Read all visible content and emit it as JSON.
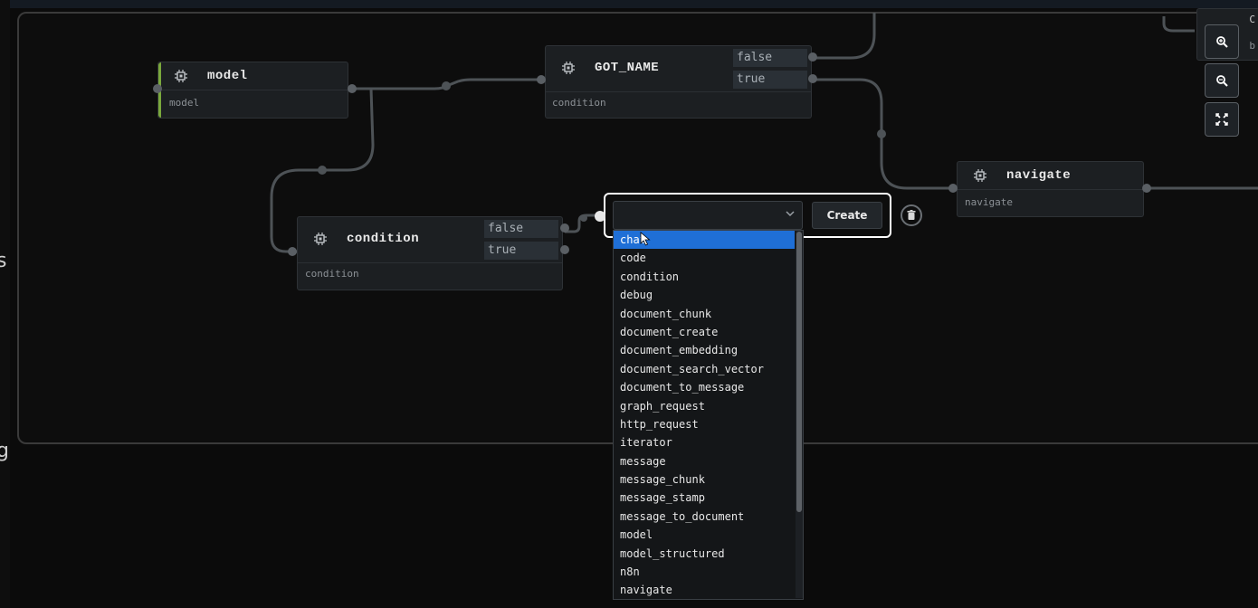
{
  "edge_text": {
    "top": "s",
    "bottom": "g"
  },
  "nodes": {
    "model": {
      "title": "model",
      "subtitle": "model"
    },
    "got_name": {
      "title": "GOT_NAME",
      "subtitle": "condition",
      "port_false": "false",
      "port_true": "true"
    },
    "condition": {
      "title": "condition",
      "subtitle": "condition",
      "port_false": "false",
      "port_true": "true"
    },
    "navigate": {
      "title": "navigate",
      "subtitle": "navigate"
    },
    "corner": {
      "title": "C",
      "subtitle": "b"
    }
  },
  "create_panel": {
    "select_value": "",
    "button_label": "Create",
    "options": [
      "chat",
      "code",
      "condition",
      "debug",
      "document_chunk",
      "document_create",
      "document_embedding",
      "document_search_vector",
      "document_to_message",
      "graph_request",
      "http_request",
      "iterator",
      "message",
      "message_chunk",
      "message_stamp",
      "message_to_document",
      "model",
      "model_structured",
      "n8n",
      "navigate"
    ],
    "selected_index": 0
  },
  "colors": {
    "accent": "#1f6fd6",
    "model_marker": "#7aa83c",
    "panel_border": "#ffffff"
  },
  "icons": [
    "chip-icon",
    "chevron-down-icon",
    "trash-icon",
    "zoom-in-icon",
    "zoom-out-icon",
    "fit-view-icon"
  ]
}
